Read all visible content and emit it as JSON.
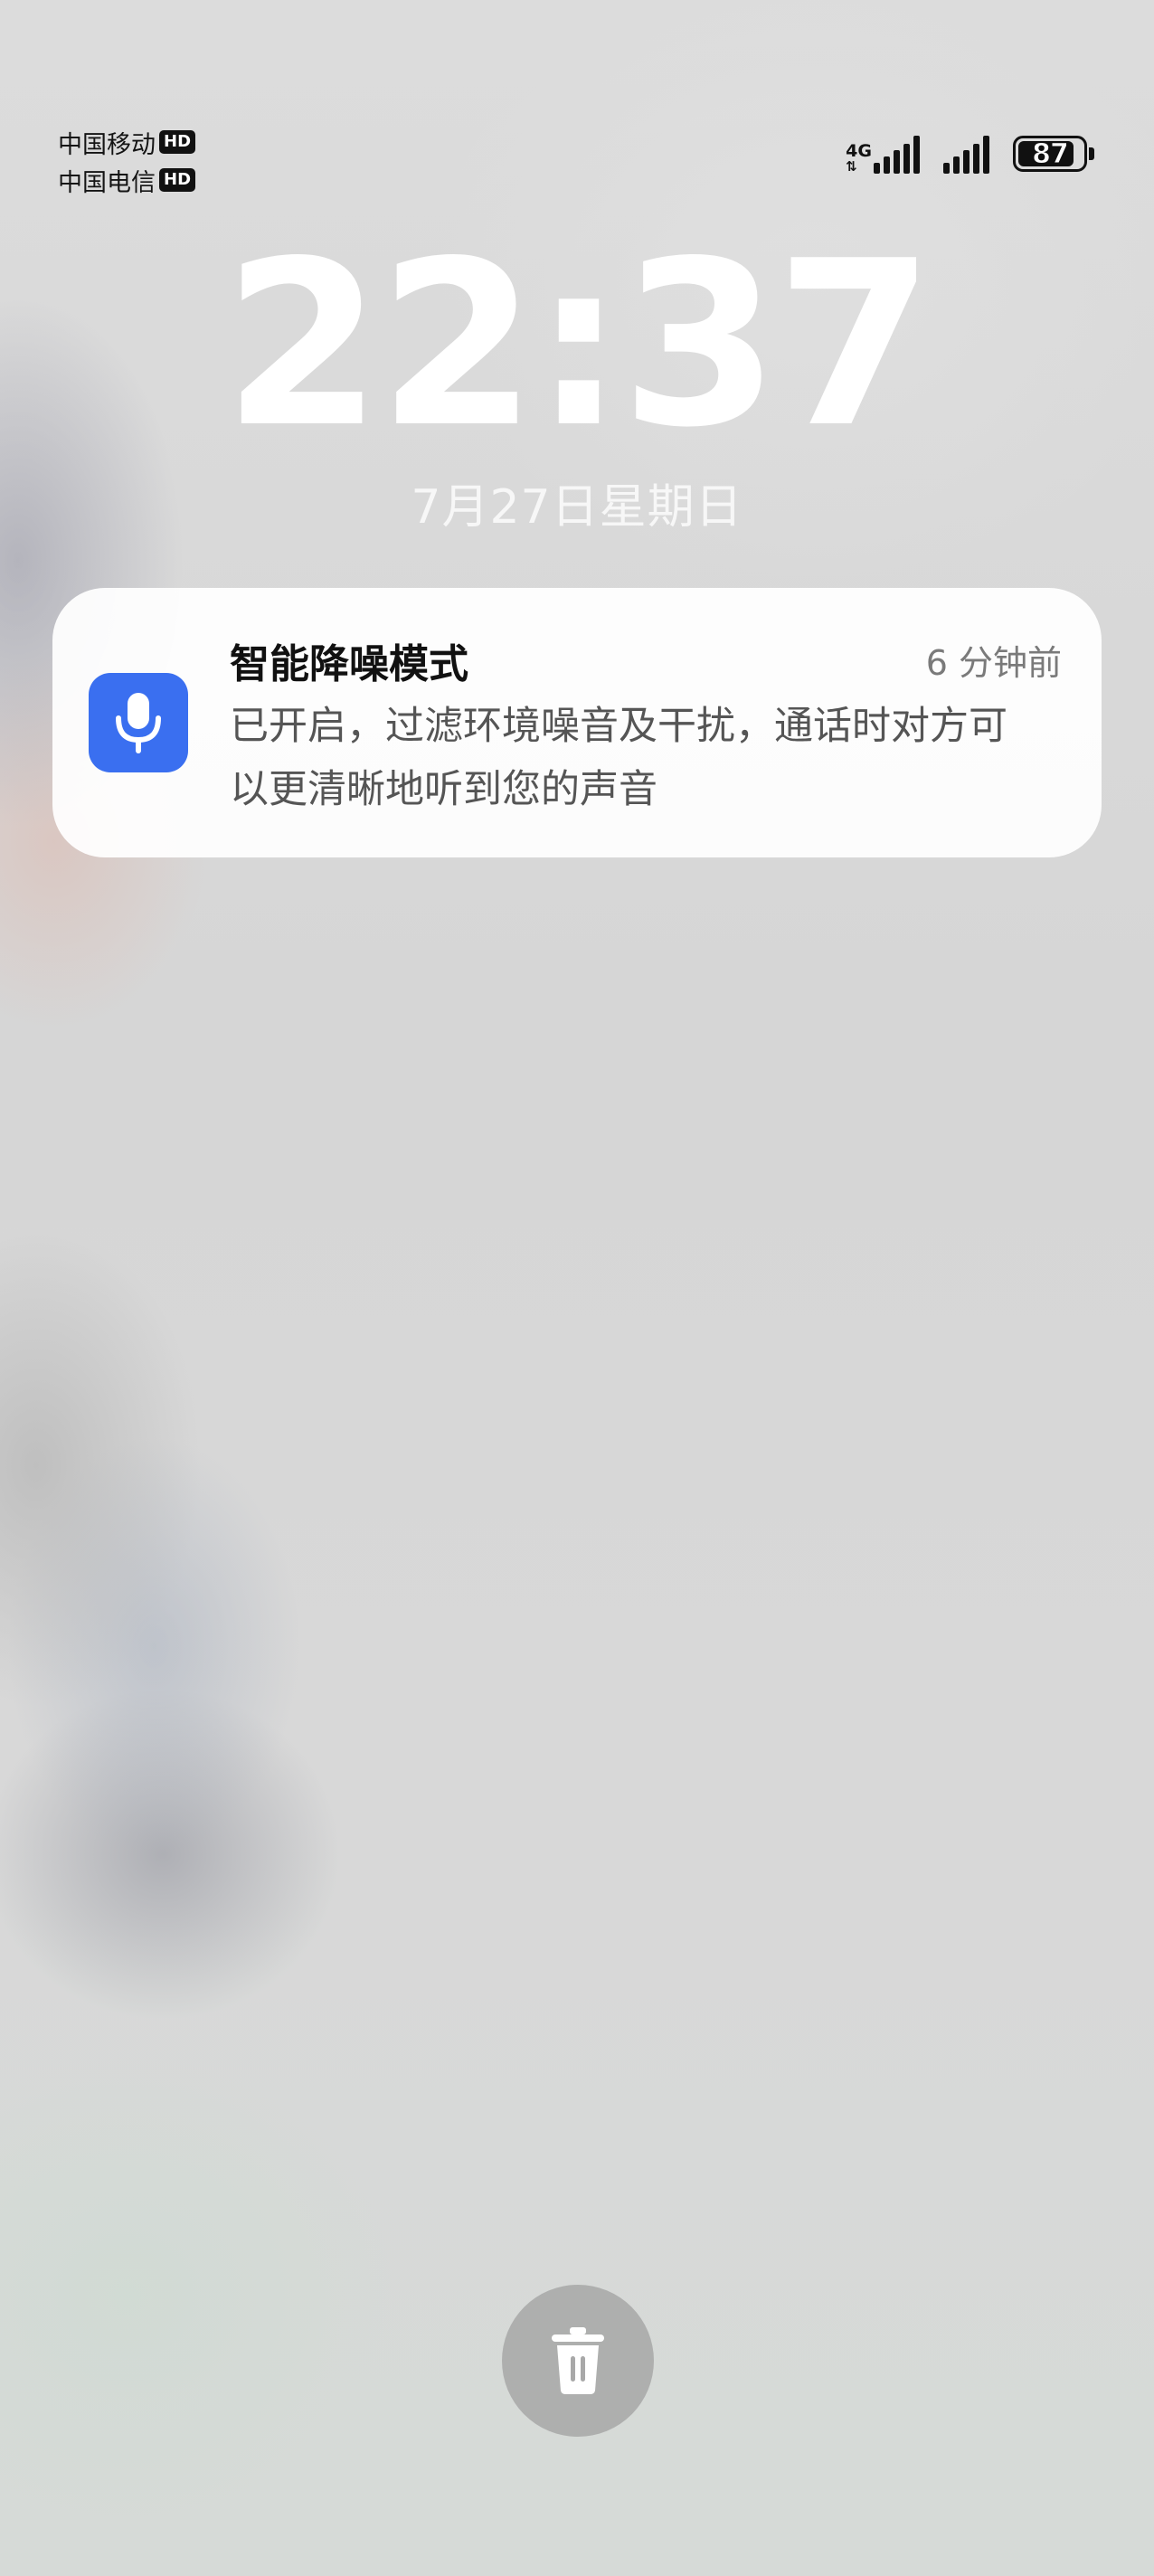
{
  "status_bar": {
    "carriers": [
      {
        "name": "中国移动",
        "badge": "HD"
      },
      {
        "name": "中国电信",
        "badge": "HD"
      }
    ],
    "network_type": "4G",
    "network_arrows": "⇅",
    "battery_level": "87",
    "battery_fraction": 0.87
  },
  "lockscreen": {
    "time": "22:37",
    "date": "7月27日星期日"
  },
  "notification": {
    "icon": "microphone-icon",
    "icon_color": "#3a6ff0",
    "title": "智能降噪模式",
    "time_ago": "6 分钟前",
    "body": "已开启，过滤环境噪音及干扰，通话时对方可以更清晰地听到您的声音"
  },
  "actions": {
    "clear_icon": "trash-icon"
  }
}
